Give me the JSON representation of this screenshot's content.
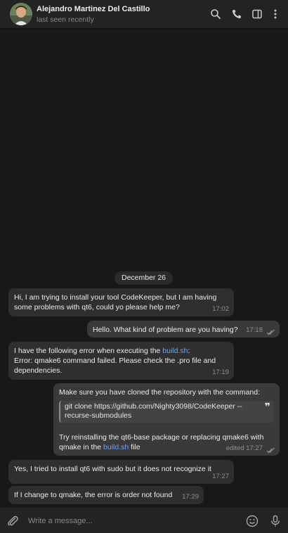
{
  "header": {
    "contact_name": "Alejandro Martinez Del Castillo",
    "status": "last seen recently",
    "icons": [
      "search-icon",
      "phone-icon",
      "sidebar-toggle-icon",
      "more-options-icon"
    ]
  },
  "chat": {
    "date_separator": "December 26",
    "messages": [
      {
        "direction": "in",
        "text": "Hi, I am trying to install your tool CodeKeeper, but I am having some problems with qt6, could yo please help me?",
        "time": "17:02"
      },
      {
        "direction": "out",
        "text": "Hello. What kind of problem are you having?",
        "time": "17:18",
        "read": true
      },
      {
        "direction": "in",
        "text_before": "I have the following error when executing the ",
        "link": "build.sh",
        "text_after": ":\nError: qmake6 command failed. Please check the .pro file and dependencies.",
        "time": "17:19"
      },
      {
        "direction": "out",
        "text_first": "Make sure you have cloned the repository with the command:",
        "quote": "git clone https://github.com/Nighty3098/CodeKeeper --recurse-submodules",
        "text_before": "Try reinstalling the qt6-base package or replacing qmake6 with qmake in the ",
        "link": "build.sh",
        "text_after": " file",
        "edited_label": "edited",
        "time": "17:27",
        "read": true
      },
      {
        "direction": "in",
        "text": "Yes, I tried to install qt6 with sudo but it does not recognize it",
        "time": "17:27"
      },
      {
        "direction": "in",
        "text": "If I change to qmake, the error is order not found",
        "time": "17:29"
      }
    ]
  },
  "composer": {
    "placeholder": "Write a message...",
    "icons": [
      "attach-icon",
      "emoji-icon",
      "microphone-icon"
    ]
  },
  "colors": {
    "background": "#181818",
    "bubble_in": "#2f2f2f",
    "bubble_out": "#3a3a3a",
    "link": "#6aa6e8"
  }
}
